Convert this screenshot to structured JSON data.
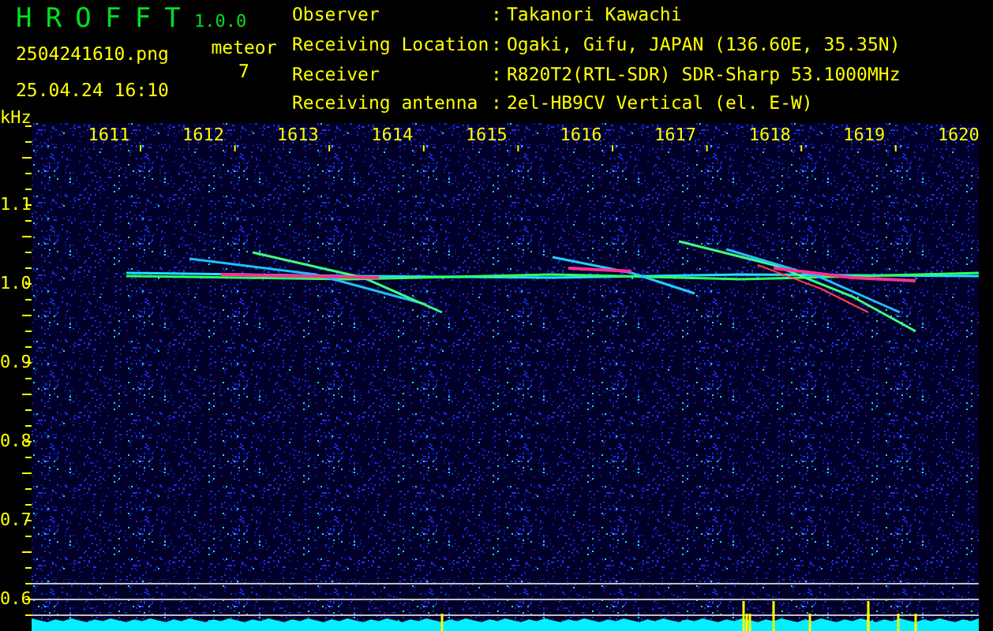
{
  "app": {
    "name": "HROFFT",
    "version": "1.0.0"
  },
  "file": {
    "name": "2504241610.png",
    "datetime": "25.04.24 16:10"
  },
  "detection": {
    "label": "meteor",
    "count": "7"
  },
  "info": [
    {
      "label": "Observer",
      "separator": ":",
      "value": "Takanori Kawachi"
    },
    {
      "label": "Receiving Location",
      "separator": ":",
      "value": "Ogaki, Gifu, JAPAN (136.60E, 35.35N)"
    },
    {
      "label": "Receiver",
      "separator": ":",
      "value": "R820T2(RTL-SDR) SDR-Sharp 53.1000MHz"
    },
    {
      "label": "Receiving antenna",
      "separator": ":",
      "value": "2el-HB9CV Vertical (el. E-W)"
    }
  ],
  "axis": {
    "unit": "kHz",
    "x_ticks": [
      "1611",
      "1612",
      "1613",
      "1614",
      "1615",
      "1616",
      "1617",
      "1618",
      "1619",
      "1620"
    ],
    "y_ticks": [
      "1.1",
      "1.0",
      "0.9",
      "0.8",
      "0.7",
      "0.6"
    ]
  }
}
